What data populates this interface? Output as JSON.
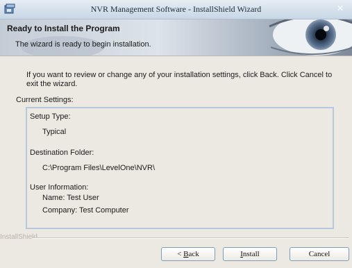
{
  "window": {
    "title": "NVR Management Software - InstallShield Wizard",
    "close_glyph": "×"
  },
  "banner": {
    "title": "Ready to Install the Program",
    "subtitle": "The wizard is ready to begin installation."
  },
  "intro": "If you want to review or change any of your installation settings, click Back. Click Cancel to exit the wizard.",
  "current_settings_label": "Current Settings:",
  "settings": {
    "setup_type_label": "Setup Type:",
    "setup_type_value": "Typical",
    "destination_label": "Destination Folder:",
    "destination_value": "C:\\Program Files\\LevelOne\\NVR\\",
    "user_info_label": "User Information:",
    "name_line": "Name: Test User",
    "company_line": "Company: Test Computer"
  },
  "footer": {
    "brand": "InstallShield"
  },
  "buttons": {
    "back_prefix": "< ",
    "back_accel": "B",
    "back_rest": "ack",
    "install_accel": "I",
    "install_rest": "nstall",
    "cancel": "Cancel"
  },
  "colors": {
    "titlebar": "#d6e1ec",
    "dialog_bg": "#ece9e2",
    "settings_border": "#b5c8de",
    "button_border": "#7f9db9"
  }
}
